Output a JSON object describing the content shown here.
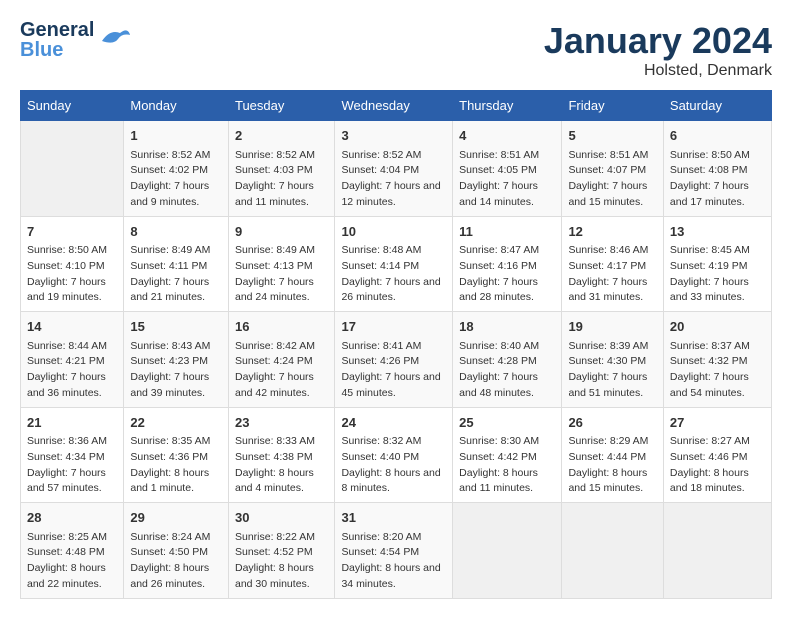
{
  "header": {
    "logo_general": "General",
    "logo_blue": "Blue",
    "month": "January 2024",
    "location": "Holsted, Denmark"
  },
  "days_of_week": [
    "Sunday",
    "Monday",
    "Tuesday",
    "Wednesday",
    "Thursday",
    "Friday",
    "Saturday"
  ],
  "weeks": [
    [
      {
        "day": "",
        "sunrise": "",
        "sunset": "",
        "daylight": ""
      },
      {
        "day": "1",
        "sunrise": "Sunrise: 8:52 AM",
        "sunset": "Sunset: 4:02 PM",
        "daylight": "Daylight: 7 hours and 9 minutes."
      },
      {
        "day": "2",
        "sunrise": "Sunrise: 8:52 AM",
        "sunset": "Sunset: 4:03 PM",
        "daylight": "Daylight: 7 hours and 11 minutes."
      },
      {
        "day": "3",
        "sunrise": "Sunrise: 8:52 AM",
        "sunset": "Sunset: 4:04 PM",
        "daylight": "Daylight: 7 hours and 12 minutes."
      },
      {
        "day": "4",
        "sunrise": "Sunrise: 8:51 AM",
        "sunset": "Sunset: 4:05 PM",
        "daylight": "Daylight: 7 hours and 14 minutes."
      },
      {
        "day": "5",
        "sunrise": "Sunrise: 8:51 AM",
        "sunset": "Sunset: 4:07 PM",
        "daylight": "Daylight: 7 hours and 15 minutes."
      },
      {
        "day": "6",
        "sunrise": "Sunrise: 8:50 AM",
        "sunset": "Sunset: 4:08 PM",
        "daylight": "Daylight: 7 hours and 17 minutes."
      }
    ],
    [
      {
        "day": "7",
        "sunrise": "Sunrise: 8:50 AM",
        "sunset": "Sunset: 4:10 PM",
        "daylight": "Daylight: 7 hours and 19 minutes."
      },
      {
        "day": "8",
        "sunrise": "Sunrise: 8:49 AM",
        "sunset": "Sunset: 4:11 PM",
        "daylight": "Daylight: 7 hours and 21 minutes."
      },
      {
        "day": "9",
        "sunrise": "Sunrise: 8:49 AM",
        "sunset": "Sunset: 4:13 PM",
        "daylight": "Daylight: 7 hours and 24 minutes."
      },
      {
        "day": "10",
        "sunrise": "Sunrise: 8:48 AM",
        "sunset": "Sunset: 4:14 PM",
        "daylight": "Daylight: 7 hours and 26 minutes."
      },
      {
        "day": "11",
        "sunrise": "Sunrise: 8:47 AM",
        "sunset": "Sunset: 4:16 PM",
        "daylight": "Daylight: 7 hours and 28 minutes."
      },
      {
        "day": "12",
        "sunrise": "Sunrise: 8:46 AM",
        "sunset": "Sunset: 4:17 PM",
        "daylight": "Daylight: 7 hours and 31 minutes."
      },
      {
        "day": "13",
        "sunrise": "Sunrise: 8:45 AM",
        "sunset": "Sunset: 4:19 PM",
        "daylight": "Daylight: 7 hours and 33 minutes."
      }
    ],
    [
      {
        "day": "14",
        "sunrise": "Sunrise: 8:44 AM",
        "sunset": "Sunset: 4:21 PM",
        "daylight": "Daylight: 7 hours and 36 minutes."
      },
      {
        "day": "15",
        "sunrise": "Sunrise: 8:43 AM",
        "sunset": "Sunset: 4:23 PM",
        "daylight": "Daylight: 7 hours and 39 minutes."
      },
      {
        "day": "16",
        "sunrise": "Sunrise: 8:42 AM",
        "sunset": "Sunset: 4:24 PM",
        "daylight": "Daylight: 7 hours and 42 minutes."
      },
      {
        "day": "17",
        "sunrise": "Sunrise: 8:41 AM",
        "sunset": "Sunset: 4:26 PM",
        "daylight": "Daylight: 7 hours and 45 minutes."
      },
      {
        "day": "18",
        "sunrise": "Sunrise: 8:40 AM",
        "sunset": "Sunset: 4:28 PM",
        "daylight": "Daylight: 7 hours and 48 minutes."
      },
      {
        "day": "19",
        "sunrise": "Sunrise: 8:39 AM",
        "sunset": "Sunset: 4:30 PM",
        "daylight": "Daylight: 7 hours and 51 minutes."
      },
      {
        "day": "20",
        "sunrise": "Sunrise: 8:37 AM",
        "sunset": "Sunset: 4:32 PM",
        "daylight": "Daylight: 7 hours and 54 minutes."
      }
    ],
    [
      {
        "day": "21",
        "sunrise": "Sunrise: 8:36 AM",
        "sunset": "Sunset: 4:34 PM",
        "daylight": "Daylight: 7 hours and 57 minutes."
      },
      {
        "day": "22",
        "sunrise": "Sunrise: 8:35 AM",
        "sunset": "Sunset: 4:36 PM",
        "daylight": "Daylight: 8 hours and 1 minute."
      },
      {
        "day": "23",
        "sunrise": "Sunrise: 8:33 AM",
        "sunset": "Sunset: 4:38 PM",
        "daylight": "Daylight: 8 hours and 4 minutes."
      },
      {
        "day": "24",
        "sunrise": "Sunrise: 8:32 AM",
        "sunset": "Sunset: 4:40 PM",
        "daylight": "Daylight: 8 hours and 8 minutes."
      },
      {
        "day": "25",
        "sunrise": "Sunrise: 8:30 AM",
        "sunset": "Sunset: 4:42 PM",
        "daylight": "Daylight: 8 hours and 11 minutes."
      },
      {
        "day": "26",
        "sunrise": "Sunrise: 8:29 AM",
        "sunset": "Sunset: 4:44 PM",
        "daylight": "Daylight: 8 hours and 15 minutes."
      },
      {
        "day": "27",
        "sunrise": "Sunrise: 8:27 AM",
        "sunset": "Sunset: 4:46 PM",
        "daylight": "Daylight: 8 hours and 18 minutes."
      }
    ],
    [
      {
        "day": "28",
        "sunrise": "Sunrise: 8:25 AM",
        "sunset": "Sunset: 4:48 PM",
        "daylight": "Daylight: 8 hours and 22 minutes."
      },
      {
        "day": "29",
        "sunrise": "Sunrise: 8:24 AM",
        "sunset": "Sunset: 4:50 PM",
        "daylight": "Daylight: 8 hours and 26 minutes."
      },
      {
        "day": "30",
        "sunrise": "Sunrise: 8:22 AM",
        "sunset": "Sunset: 4:52 PM",
        "daylight": "Daylight: 8 hours and 30 minutes."
      },
      {
        "day": "31",
        "sunrise": "Sunrise: 8:20 AM",
        "sunset": "Sunset: 4:54 PM",
        "daylight": "Daylight: 8 hours and 34 minutes."
      },
      {
        "day": "",
        "sunrise": "",
        "sunset": "",
        "daylight": ""
      },
      {
        "day": "",
        "sunrise": "",
        "sunset": "",
        "daylight": ""
      },
      {
        "day": "",
        "sunrise": "",
        "sunset": "",
        "daylight": ""
      }
    ]
  ]
}
